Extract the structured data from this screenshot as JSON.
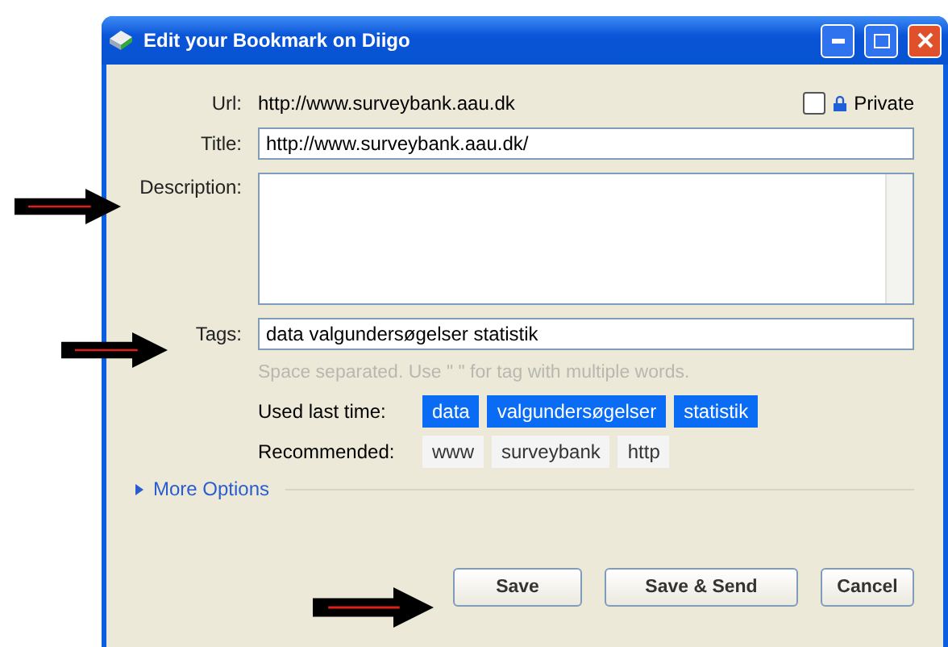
{
  "window": {
    "title": "Edit your Bookmark on Diigo"
  },
  "url": {
    "label": "Url:",
    "value": "http://www.surveybank.aau.dk"
  },
  "private": {
    "label": "Private",
    "checked": false
  },
  "title_field": {
    "label": "Title:",
    "value": "http://www.surveybank.aau.dk/"
  },
  "description_field": {
    "label": "Description:"
  },
  "tags_field": {
    "label": "Tags:",
    "value": "data valgundersøgelser statistik",
    "hint": "Space separated. Use \" \" for tag with multiple words."
  },
  "tag_rows": [
    {
      "label": "Used last time:",
      "tags": [
        {
          "text": "data",
          "selected": true
        },
        {
          "text": "valgundersøgelser",
          "selected": true
        },
        {
          "text": "statistik",
          "selected": true
        }
      ]
    },
    {
      "label": "Recommended:",
      "tags": [
        {
          "text": "www",
          "selected": false
        },
        {
          "text": "surveybank",
          "selected": false
        },
        {
          "text": "http",
          "selected": false
        }
      ]
    }
  ],
  "more_options": {
    "label": "More Options",
    "expanded": false
  },
  "buttons": [
    "Save",
    "Save & Send",
    "Cancel"
  ]
}
